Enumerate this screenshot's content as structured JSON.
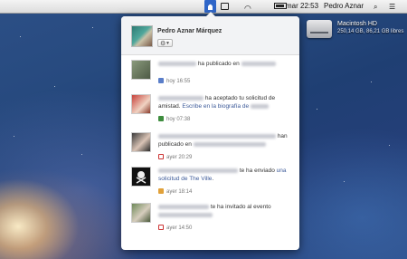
{
  "menubar": {
    "clock": "mar 22:53",
    "user": "Pedro Aznar"
  },
  "desktop": {
    "drive_name": "Macintosh HD",
    "drive_info": "250,14 GB, 86,21 GB libres"
  },
  "popover": {
    "profile_name": "Pedro Aznar Márquez",
    "gear_symbol": "⚙",
    "notifications": [
      {
        "text_before": "",
        "action": "ha publicado en",
        "link": "",
        "text_after": "",
        "time": "hoy 16:55",
        "icon": "post-icon"
      },
      {
        "text_before": "",
        "action": "ha aceptado tu solicitud de amistad.",
        "link": "Escribe en la biografía de",
        "text_after": "",
        "time": "hoy 07:38",
        "icon": "friend-icon"
      },
      {
        "text_before": "",
        "action": "han publicado en",
        "link": "",
        "text_after": "",
        "time": "ayer 20:29",
        "icon": "calendar-icon"
      },
      {
        "text_before": "",
        "action": "te ha enviado",
        "link": "una solicitud",
        "link2": "de The Ville",
        "text_after": ".",
        "time": "ayer 18:14",
        "icon": "app-icon"
      },
      {
        "text_before": "",
        "action": "te ha invitado al evento",
        "link": "",
        "text_after": "",
        "time": "ayer 14:50",
        "icon": "calendar-icon"
      }
    ]
  },
  "colors": {
    "facebook_blue": "#3b5998",
    "menubar_fb_highlight": "#2f66c8"
  }
}
